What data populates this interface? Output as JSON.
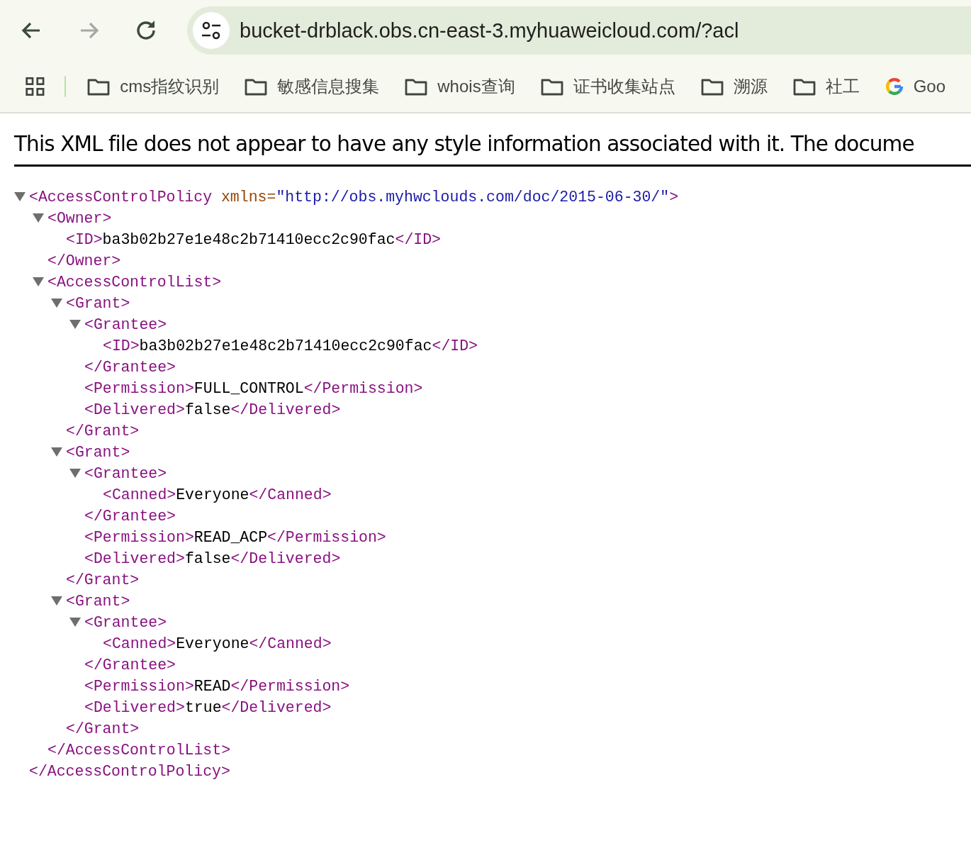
{
  "toolbar": {
    "url": "bucket-drblack.obs.cn-east-3.myhuaweicloud.com/?acl",
    "back_disabled": false,
    "forward_disabled": true
  },
  "bookmarks": [
    {
      "kind": "folder",
      "label": "cms指纹识别"
    },
    {
      "kind": "folder",
      "label": "敏感信息搜集"
    },
    {
      "kind": "folder",
      "label": "whois查询"
    },
    {
      "kind": "folder",
      "label": "证书收集站点"
    },
    {
      "kind": "folder",
      "label": "溯源"
    },
    {
      "kind": "folder",
      "label": "社工"
    },
    {
      "kind": "site",
      "label": "Goo"
    }
  ],
  "notice": "This XML file does not appear to have any style information associated with it. The docume",
  "xml": {
    "open": "<AccessControlPolicy",
    "attr_name": " xmlns=",
    "attr_value": "\"http://obs.myhwclouds.com/doc/2015-06-30/\"",
    "open_end": ">",
    "close": "</AccessControlPolicy>",
    "expanded": true,
    "children": [
      {
        "open": "<Owner>",
        "close": "</Owner>",
        "expanded": true,
        "children": [
          {
            "open": "<ID>",
            "text": "ba3b02b27e1e48c2b71410ecc2c90fac",
            "close": "</ID>"
          }
        ]
      },
      {
        "open": "<AccessControlList>",
        "close": "</AccessControlList>",
        "expanded": true,
        "children": [
          {
            "open": "<Grant>",
            "close": "</Grant>",
            "expanded": true,
            "children": [
              {
                "open": "<Grantee>",
                "close": "</Grantee>",
                "expanded": true,
                "children": [
                  {
                    "open": "<ID>",
                    "text": "ba3b02b27e1e48c2b71410ecc2c90fac",
                    "close": "</ID>"
                  }
                ]
              },
              {
                "open": "<Permission>",
                "text": "FULL_CONTROL",
                "close": "</Permission>"
              },
              {
                "open": "<Delivered>",
                "text": "false",
                "close": "</Delivered>"
              }
            ]
          },
          {
            "open": "<Grant>",
            "close": "</Grant>",
            "expanded": true,
            "children": [
              {
                "open": "<Grantee>",
                "close": "</Grantee>",
                "expanded": true,
                "children": [
                  {
                    "open": "<Canned>",
                    "text": "Everyone",
                    "close": "</Canned>"
                  }
                ]
              },
              {
                "open": "<Permission>",
                "text": "READ_ACP",
                "close": "</Permission>"
              },
              {
                "open": "<Delivered>",
                "text": "false",
                "close": "</Delivered>"
              }
            ]
          },
          {
            "open": "<Grant>",
            "close": "</Grant>",
            "expanded": true,
            "children": [
              {
                "open": "<Grantee>",
                "close": "</Grantee>",
                "expanded": true,
                "children": [
                  {
                    "open": "<Canned>",
                    "text": "Everyone",
                    "close": "</Canned>"
                  }
                ]
              },
              {
                "open": "<Permission>",
                "text": "READ",
                "close": "</Permission>"
              },
              {
                "open": "<Delivered>",
                "text": "true",
                "close": "</Delivered>"
              }
            ]
          }
        ]
      }
    ]
  }
}
